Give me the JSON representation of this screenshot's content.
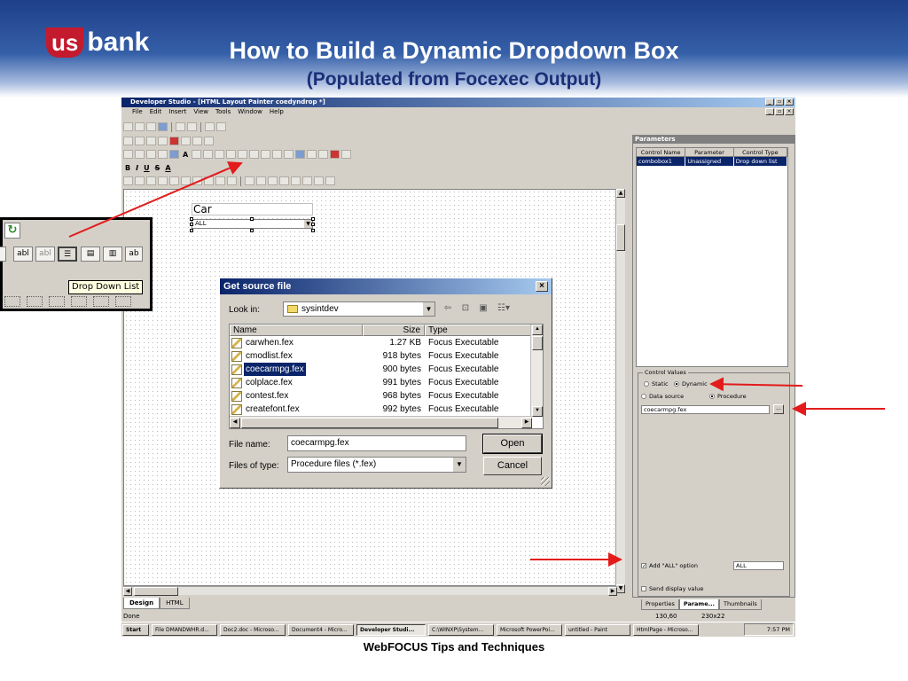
{
  "slide": {
    "logo_us": "us",
    "logo_bank": "bank",
    "title": "How to Build a Dynamic Dropdown Box",
    "subtitle": "(Populated from Focexec Output)",
    "footer": "WebFOCUS Tips and Techniques"
  },
  "app": {
    "window_title": "Developer Studio - [HTML Layout Painter coedyndrop *]",
    "menu": [
      "File",
      "Edit",
      "Insert",
      "View",
      "Tools",
      "Window",
      "Help"
    ],
    "format_toolbar": {
      "bold": "B",
      "italic": "I",
      "underline": "U",
      "strike": "S",
      "font_color": "A"
    },
    "canvas": {
      "label_text": "Car",
      "combo_value": "ALL"
    },
    "design_tabs": [
      "Design",
      "HTML"
    ],
    "status": {
      "left": "Done",
      "position": "130,60",
      "size": "230x22"
    }
  },
  "parameters_panel": {
    "title": "Parameters",
    "columns": [
      "Control Name",
      "Parameter",
      "Control Type"
    ],
    "rows": [
      {
        "control_name": "combobox1",
        "parameter": "Unassigned",
        "control_type": "Drop down list"
      }
    ],
    "control_values": {
      "legend": "Control Values",
      "static_label": "Static",
      "dynamic_label": "Dynamic",
      "datasource_label": "Data source",
      "procedure_label": "Procedure",
      "procedure_value": "coecarmpg.fex",
      "browse_label": "...",
      "add_all_label": "Add \"ALL\" option",
      "add_all_value": "ALL",
      "send_display_label": "Send display value"
    },
    "tabs": [
      "Properties",
      "Parame...",
      "Thumbnails"
    ]
  },
  "dialog": {
    "title": "Get source file",
    "close_label": "×",
    "look_in_label": "Look in:",
    "look_in_value": "sysintdev",
    "columns": {
      "name": "Name",
      "size": "Size",
      "type": "Type"
    },
    "files": [
      {
        "name": "carwhen.fex",
        "size": "1.27 KB",
        "type": "Focus Executable"
      },
      {
        "name": "cmodlist.fex",
        "size": "918 bytes",
        "type": "Focus Executable"
      },
      {
        "name": "coecarmpg.fex",
        "size": "900 bytes",
        "type": "Focus Executable"
      },
      {
        "name": "colplace.fex",
        "size": "991 bytes",
        "type": "Focus Executable"
      },
      {
        "name": "contest.fex",
        "size": "968 bytes",
        "type": "Focus Executable"
      },
      {
        "name": "createfont.fex",
        "size": "992 bytes",
        "type": "Focus Executable"
      }
    ],
    "selected_file": "coecarmpg.fex",
    "file_name_label": "File name:",
    "file_name_value": "coecarmpg.fex",
    "files_of_type_label": "Files of type:",
    "files_of_type_value": "Procedure files (*.fex)",
    "open_label": "Open",
    "cancel_label": "Cancel"
  },
  "callout": {
    "buttons": [
      "abl",
      "abl",
      "",
      "",
      "",
      "ab"
    ],
    "tooltip": "Drop Down List"
  },
  "taskbar": {
    "start": "Start",
    "tasks": [
      "File DMANDWHR.d...",
      "Doc2.doc - Microso...",
      "Document4 - Micro...",
      "Developer Studi...",
      "C:\\WINXP\\System...",
      "Microsoft PowerPoi...",
      "untitled - Paint",
      "HtmlPage - Microso..."
    ],
    "active_task": "Developer Studi...",
    "clock": "7:57 PM"
  },
  "colors": {
    "arrow_red": "#e31b1b",
    "titlebar_blue": "#0a246a",
    "slide_title_dark": "#1a2f78",
    "logo_red": "#c41a2e"
  }
}
